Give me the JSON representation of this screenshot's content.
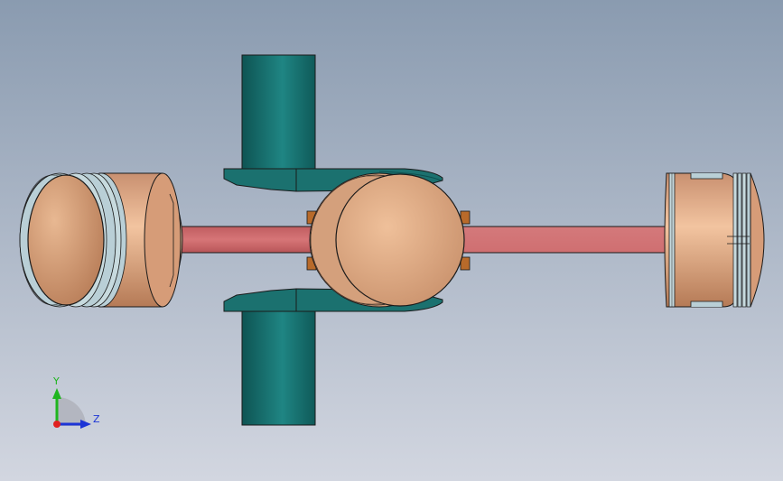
{
  "viewport": {
    "background_top": "#8a9bb0",
    "background_bottom": "#d2d6e0"
  },
  "colors": {
    "piston": "#d9a582",
    "piston_dark": "#9b6a4e",
    "piston_face": "#c48b66",
    "rings": "#b9cfd6",
    "rod": "#cc6a6c",
    "rod_dark": "#9e4a4c",
    "yoke": "#1f7a78",
    "yoke_dark": "#0d4f4e",
    "bushing": "#b86a2a",
    "axis_y": "#1fb51f",
    "axis_z": "#1d35d6",
    "axis_x": "#e02020",
    "outline": "#1a1a1a"
  },
  "triad": {
    "y_label": "Y",
    "z_label": "Z",
    "y_icon": "axis-y-arrow-icon",
    "z_icon": "axis-z-arrow-icon",
    "origin_icon": "axis-origin-icon"
  }
}
